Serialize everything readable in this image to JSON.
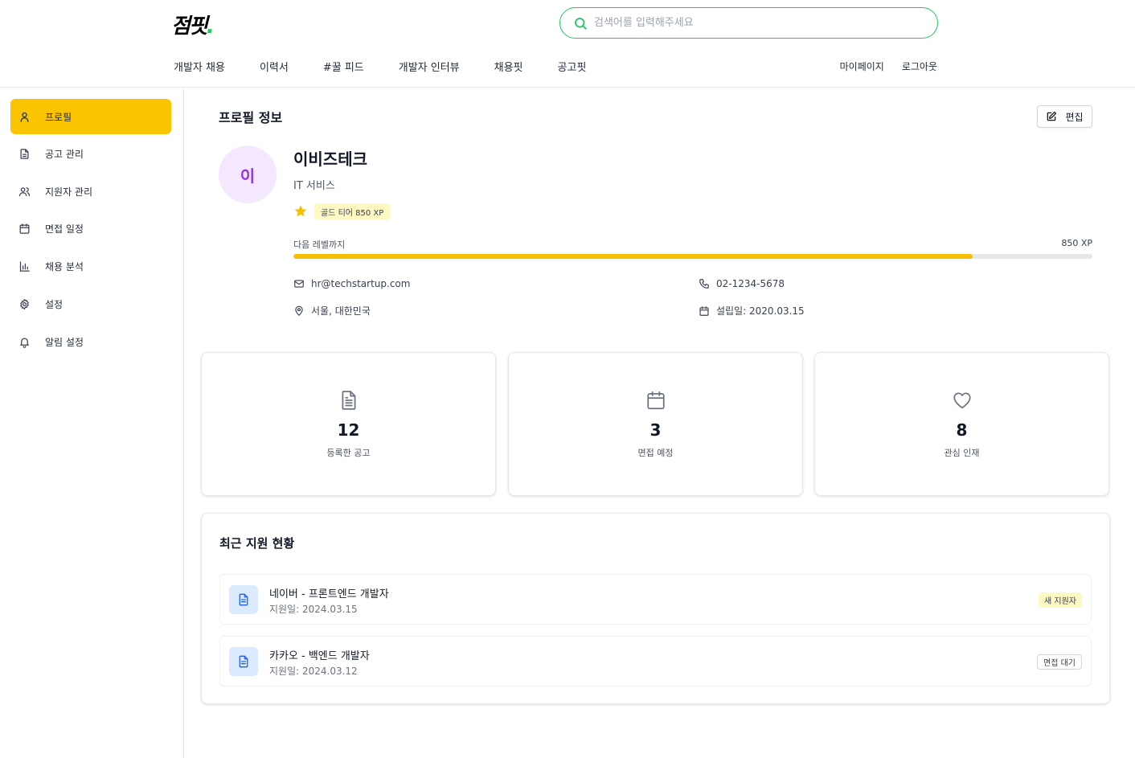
{
  "header": {
    "logo_text": "점핏",
    "logo_dot": ".",
    "search_placeholder": "검색어를 입력해주세요",
    "nav": [
      "개발자 채용",
      "이력서",
      "#꿀 피드",
      "개발자 인터뷰",
      "채용핏",
      "공고핏"
    ],
    "mypage": "마이페이지",
    "logout": "로그아웃"
  },
  "sidebar": {
    "items": [
      {
        "label": "프로필",
        "icon": "user-icon",
        "active": true
      },
      {
        "label": "공고 관리",
        "icon": "document-icon"
      },
      {
        "label": "지원자 관리",
        "icon": "users-icon"
      },
      {
        "label": "면접 일정",
        "icon": "calendar-icon"
      },
      {
        "label": "채용 분석",
        "icon": "bar-chart-icon"
      },
      {
        "label": "설정",
        "icon": "gear-icon"
      },
      {
        "label": "알림 설정",
        "icon": "bell-icon"
      }
    ]
  },
  "profile": {
    "section_title": "프로필 정보",
    "edit_label": "편집",
    "avatar_initial": "이",
    "company_name": "이비즈테크",
    "category": "IT 서비스",
    "tier_badge": "골드 티어 850 XP",
    "next_level_label": "다음 레벨까지",
    "next_level_value": "850 XP",
    "progress_percent": 85,
    "email": "hr@techstartup.com",
    "phone": "02-1234-5678",
    "location": "서울, 대한민국",
    "founded": "설립일: 2020.03.15"
  },
  "stats": [
    {
      "value": "12",
      "label": "등록한 공고",
      "icon": "document-icon"
    },
    {
      "value": "3",
      "label": "면접 예정",
      "icon": "calendar-icon"
    },
    {
      "value": "8",
      "label": "관심 인재",
      "icon": "heart-icon"
    }
  ],
  "recent": {
    "title": "최근 지원 현황",
    "items": [
      {
        "title": "네이버 - 프론트엔드 개발자",
        "date": "지원일: 2024.03.15",
        "badge": "새 지원자"
      },
      {
        "title": "카카오 - 백엔드 개발자",
        "date": "지원일: 2024.03.12",
        "badge": "면접 대기"
      }
    ]
  },
  "colors": {
    "accent": "#fbc400",
    "brand_green": "#22c55e",
    "avatar_bg": "#f3e8ff",
    "avatar_text": "#9333ea"
  }
}
